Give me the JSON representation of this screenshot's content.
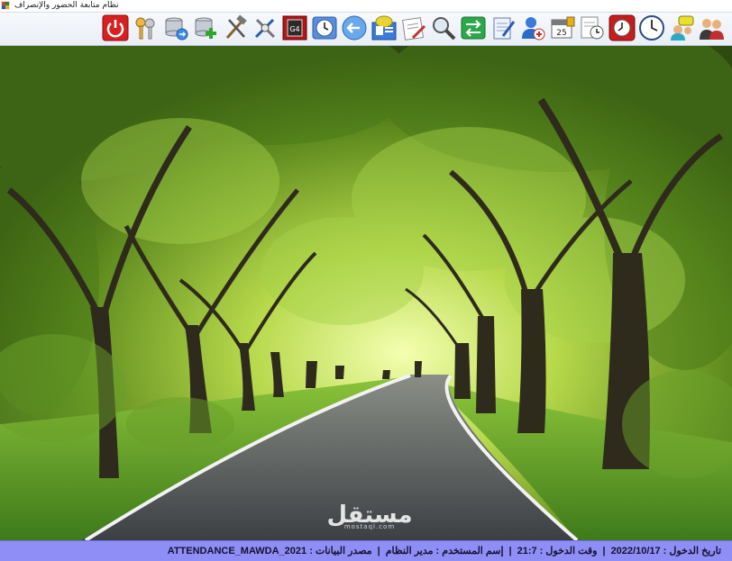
{
  "window": {
    "title": "نظام متابعة الحضور والإنصراف"
  },
  "toolbar": {
    "buttons": [
      {
        "icon": "power-icon"
      },
      {
        "icon": "keys-icon"
      },
      {
        "icon": "database-sync-icon"
      },
      {
        "icon": "database-add-icon"
      },
      {
        "icon": "tools-icon"
      },
      {
        "icon": "settings-tools-icon"
      },
      {
        "icon": "calculator-icon"
      },
      {
        "icon": "clock-icon"
      },
      {
        "icon": "back-arrow-icon"
      },
      {
        "icon": "user-card-icon"
      },
      {
        "icon": "document-edit-icon"
      },
      {
        "icon": "search-icon"
      },
      {
        "icon": "transfer-icon"
      },
      {
        "icon": "notepad-icon"
      },
      {
        "icon": "user-add-icon"
      },
      {
        "icon": "calendar-icon"
      },
      {
        "icon": "report-clock-icon"
      },
      {
        "icon": "alarm-icon"
      },
      {
        "icon": "wall-clock-icon"
      },
      {
        "icon": "chat-users-icon"
      },
      {
        "icon": "users-icon"
      }
    ]
  },
  "status": {
    "login_date": "تاريخ الدخول : 2022/10/17",
    "login_time": "وقت الدخول : 21:7",
    "username": "إسم المستخدم : مدير النظام",
    "data_source": "مصدر البيانات : ATTENDANCE_MAWDA_2021"
  },
  "watermark": {
    "text": "مستقل",
    "sub": "mostaql.com"
  },
  "colors": {
    "status_bar": "#8f8ef7",
    "toolbar": "#eef2f8"
  }
}
